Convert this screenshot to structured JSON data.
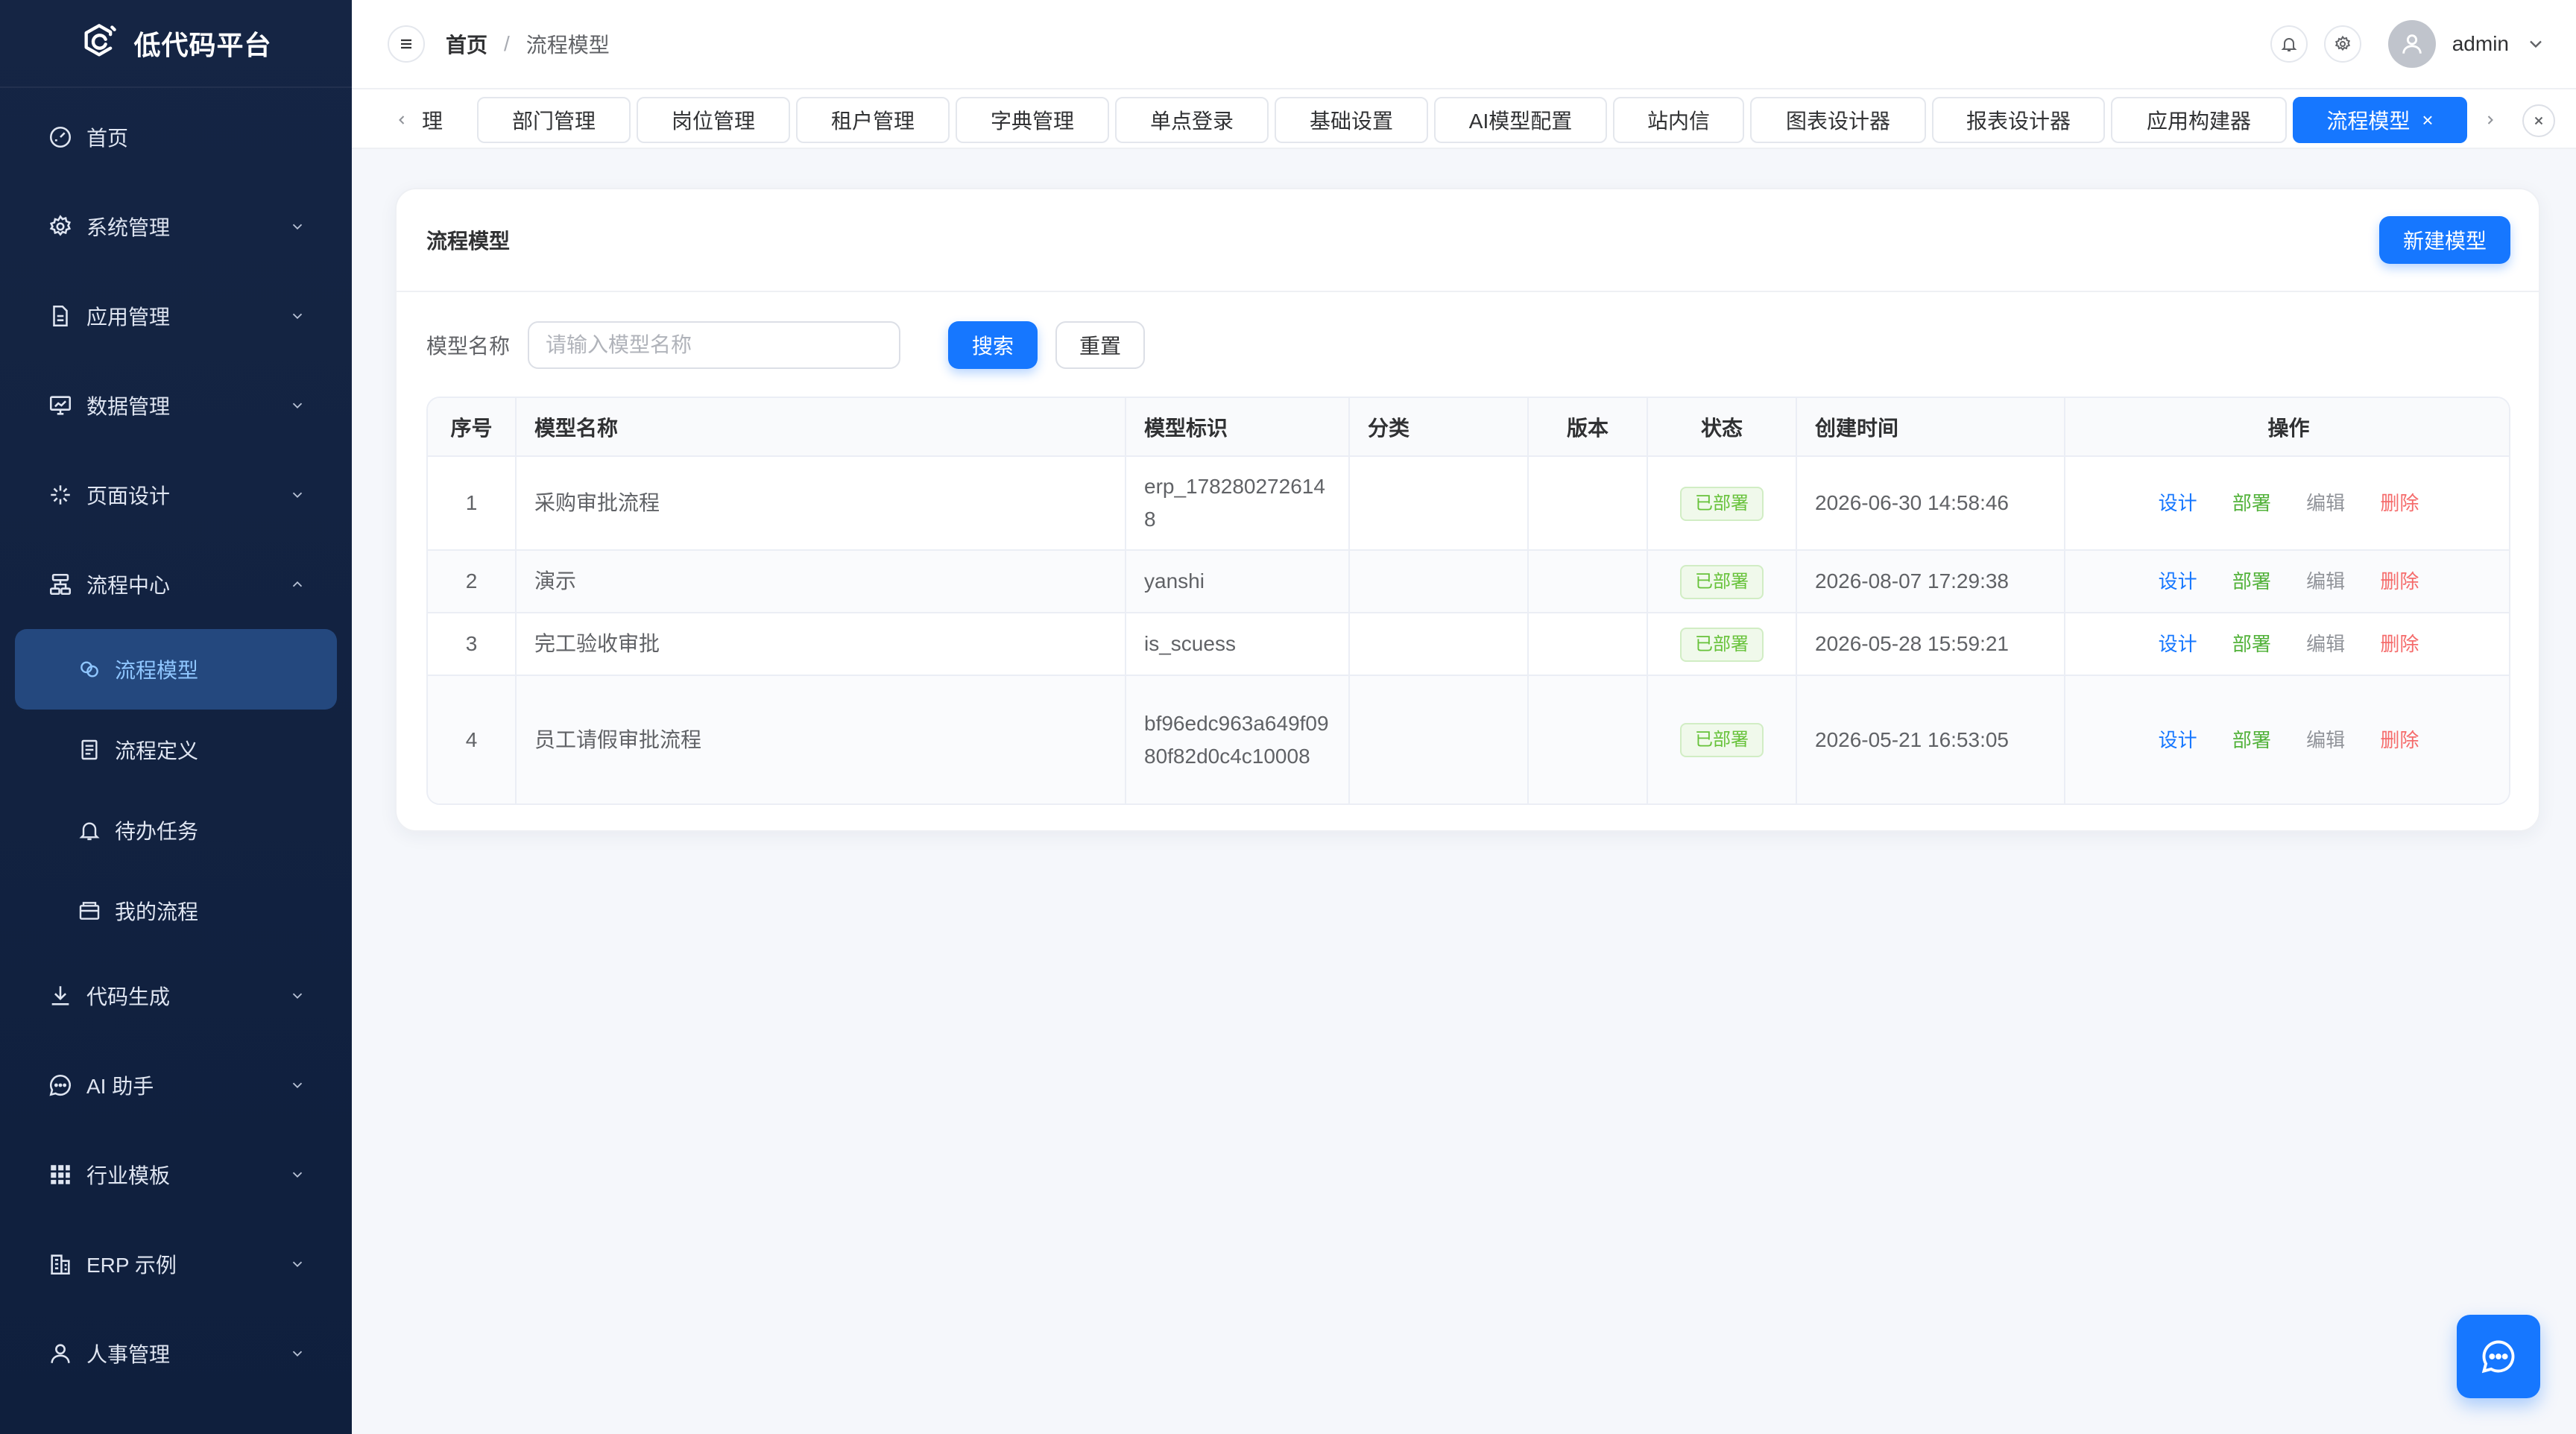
{
  "app": {
    "name": "低代码平台"
  },
  "sidebar": {
    "items": [
      {
        "label": "首页",
        "icon": "dashboard-icon"
      },
      {
        "label": "系统管理",
        "icon": "gear-icon"
      },
      {
        "label": "应用管理",
        "icon": "document-icon"
      },
      {
        "label": "数据管理",
        "icon": "monitor-icon"
      },
      {
        "label": "页面设计",
        "icon": "sparkle-icon"
      },
      {
        "label": "流程中心",
        "icon": "flow-icon",
        "expanded": true
      },
      {
        "label": "代码生成",
        "icon": "download-icon"
      },
      {
        "label": "AI 助手",
        "icon": "chat-icon"
      },
      {
        "label": "行业模板",
        "icon": "grid-icon"
      },
      {
        "label": "ERP 示例",
        "icon": "building-icon"
      },
      {
        "label": "人事管理",
        "icon": "user-icon"
      }
    ],
    "sub_items": [
      {
        "label": "流程模型",
        "icon": "model-icon",
        "active": true
      },
      {
        "label": "流程定义",
        "icon": "list-icon"
      },
      {
        "label": "待办任务",
        "icon": "bell-icon"
      },
      {
        "label": "我的流程",
        "icon": "folder-icon"
      }
    ]
  },
  "header": {
    "breadcrumb": [
      "首页",
      "流程模型"
    ],
    "breadcrumb_sep": "/",
    "username": "admin"
  },
  "tabs": [
    {
      "label": "理"
    },
    {
      "label": "部门管理"
    },
    {
      "label": "岗位管理"
    },
    {
      "label": "租户管理"
    },
    {
      "label": "字典管理"
    },
    {
      "label": "单点登录"
    },
    {
      "label": "基础设置"
    },
    {
      "label": "AI模型配置"
    },
    {
      "label": "站内信"
    },
    {
      "label": "图表设计器"
    },
    {
      "label": "报表设计器"
    },
    {
      "label": "应用构建器"
    },
    {
      "label": "流程模型",
      "active": true,
      "close": "×"
    }
  ],
  "card": {
    "title": "流程模型",
    "new_button": "新建模型",
    "search": {
      "label": "模型名称",
      "placeholder": "请输入模型名称",
      "value": "",
      "search_button": "搜索",
      "reset_button": "重置"
    }
  },
  "table": {
    "columns": [
      "序号",
      "模型名称",
      "模型标识",
      "分类",
      "版本",
      "状态",
      "创建时间",
      "操作"
    ],
    "rows": [
      {
        "index": "1",
        "name": "采购审批流程",
        "key": "erp_1782802726148",
        "category": "",
        "version": "",
        "status": "已部署",
        "created": "2026-06-30 14:58:46"
      },
      {
        "index": "2",
        "name": "演示",
        "key": "yanshi",
        "category": "",
        "version": "",
        "status": "已部署",
        "created": "2026-08-07 17:29:38"
      },
      {
        "index": "3",
        "name": "完工验收审批",
        "key": "is_scuess",
        "category": "",
        "version": "",
        "status": "已部署",
        "created": "2026-05-28 15:59:21"
      },
      {
        "index": "4",
        "name": "员工请假审批流程",
        "key": "bf96edc963a649f0980f82d0c4c10008",
        "category": "",
        "version": "",
        "status": "已部署",
        "created": "2026-05-21 16:53:05"
      }
    ],
    "actions": {
      "design": "设计",
      "deploy": "部署",
      "edit": "编辑",
      "delete": "删除"
    }
  },
  "colors": {
    "primary": "#1677ff",
    "sidebar_bg": "#13233f",
    "sidebar_active_bg": "#24487e",
    "success": "#67c23a",
    "danger": "#f56c6c"
  }
}
